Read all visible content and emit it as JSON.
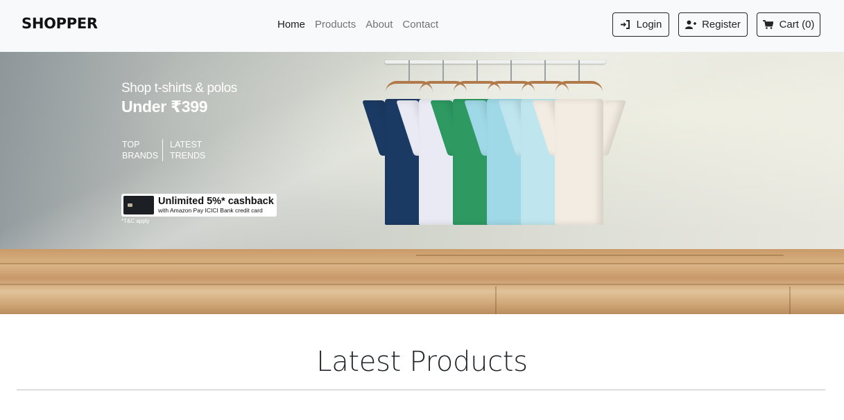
{
  "navbar": {
    "brand": "SHOPPER",
    "links": [
      {
        "label": "Home",
        "active": true
      },
      {
        "label": "Products",
        "active": false
      },
      {
        "label": "About",
        "active": false
      },
      {
        "label": "Contact",
        "active": false
      }
    ],
    "buttons": {
      "login": {
        "label": "Login",
        "icon": "sign-in-icon"
      },
      "register": {
        "label": "Register",
        "icon": "user-plus-icon"
      },
      "cart": {
        "label": "Cart (0)",
        "icon": "shopping-cart-icon"
      }
    }
  },
  "hero": {
    "line1": "Shop t-shirts & polos",
    "line2": "Under ₹399",
    "tags": [
      "TOP BRANDS",
      "LATEST TRENDS"
    ],
    "cashback_main": "Unlimited 5%* cashback",
    "cashback_sub": "with Amazon Pay ICICI Bank credit card",
    "terms": "*T&C apply",
    "shirt_colors": [
      "#1b3a63",
      "#eaeaf4",
      "#2e9a62",
      "#9fd8e6",
      "#bfe6ef",
      "#f2ece2"
    ]
  },
  "section": {
    "title": "Latest Products"
  }
}
